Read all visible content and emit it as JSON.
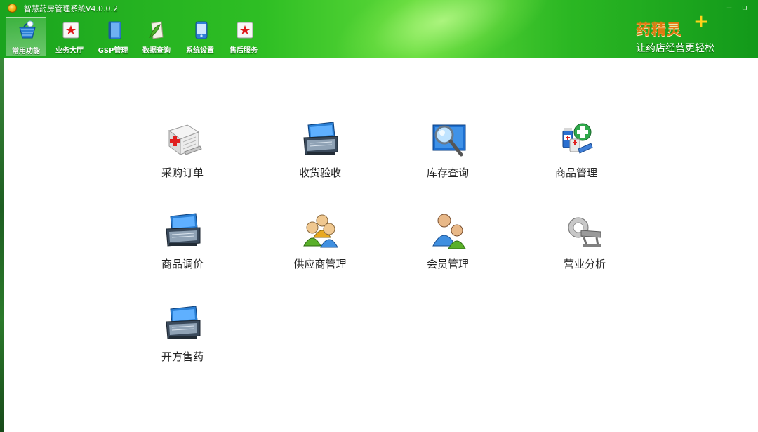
{
  "window": {
    "title": "智慧药房管理系统V4.0.0.2",
    "minimize_glyph": "—",
    "maximize_glyph": "❐"
  },
  "toolbar": {
    "items": [
      {
        "label": "常用功能",
        "icon": "basket-icon",
        "active": true
      },
      {
        "label": "业务大厅",
        "icon": "star-badge-icon"
      },
      {
        "label": "GSP管理",
        "icon": "book-icon"
      },
      {
        "label": "数据查询",
        "icon": "document-leaf-icon"
      },
      {
        "label": "系统设置",
        "icon": "device-icon"
      },
      {
        "label": "售后服务",
        "icon": "star-badge-icon"
      }
    ]
  },
  "brand": {
    "name": "药精灵",
    "plus": "+",
    "slogan": "让药店经营更轻松"
  },
  "functions": [
    {
      "label": "采购订单",
      "icon": "hospital-icon"
    },
    {
      "label": "收货验收",
      "icon": "toolbox-icon"
    },
    {
      "label": "库存查询",
      "icon": "magnifier-screen-icon"
    },
    {
      "label": "商品管理",
      "icon": "medicine-bottles-icon"
    },
    {
      "label": "商品调价",
      "icon": "toolbox-icon"
    },
    {
      "label": "供应商管理",
      "icon": "user-group-icon"
    },
    {
      "label": "会员管理",
      "icon": "users-icon"
    },
    {
      "label": "营业分析",
      "icon": "scanner-icon"
    },
    {
      "label": "开方售药",
      "icon": "toolbox-icon"
    }
  ],
  "colors": {
    "banner_green": "#2fbf24",
    "brand_orange": "#e07a10",
    "brand_plus": "#ffd21a"
  }
}
